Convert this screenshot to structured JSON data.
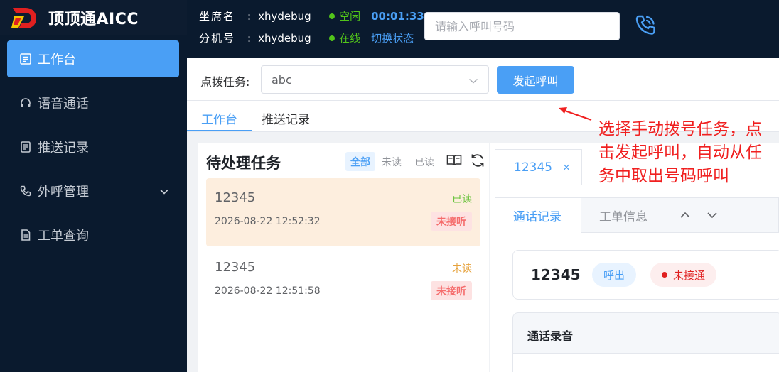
{
  "brand": {
    "title": "顶顶通AICC",
    "logo_colors": [
      "#e02020",
      "#f5c400"
    ]
  },
  "sidebar": {
    "items": [
      {
        "label": "工作台",
        "icon": "dashboard-icon",
        "active": true
      },
      {
        "label": "语音通话",
        "icon": "headset-icon"
      },
      {
        "label": "推送记录",
        "icon": "record-icon"
      },
      {
        "label": "外呼管理",
        "icon": "phone-icon",
        "expandable": true
      },
      {
        "label": "工单查询",
        "icon": "document-icon"
      }
    ]
  },
  "agent": {
    "name_label": "坐席名",
    "name_value": "xhydebug",
    "status": "空闲",
    "timer": "00:01:33",
    "ext_label": "分机号",
    "ext_value": "xhydebug",
    "online": "在线",
    "switch_label": "切换状态",
    "colon": ":"
  },
  "dial": {
    "placeholder": "请输入呼叫号码"
  },
  "task": {
    "label": "点拨任务:",
    "selected": "abc",
    "call_button": "发起呼叫"
  },
  "tabs": [
    "工作台",
    "推送记录"
  ],
  "pending": {
    "title": "待处理任务",
    "filters": [
      "全部",
      "未读",
      "已读"
    ],
    "items": [
      {
        "number": "12345",
        "time": "2026-08-22 12:52:32",
        "read_status": "已读",
        "call_status": "未接听",
        "selected": true
      },
      {
        "number": "12345",
        "time": "2026-08-22 12:51:58",
        "read_status": "未读",
        "call_status": "未接听",
        "selected": false
      }
    ]
  },
  "detail": {
    "tab_number": "12345",
    "tab_close": "×",
    "sub_tabs": [
      "通话记录",
      "工单信息"
    ],
    "call": {
      "number": "12345",
      "direction": "呼出",
      "status": "未接通"
    },
    "recording_title": "通话录音"
  },
  "annotation": {
    "text": "选择手动拨号任务，点击发起呼叫，自动从任务中取出号码呼叫"
  },
  "colors": {
    "accent": "#4a9ff5",
    "sidebar_bg": "#0a1a2e",
    "danger": "#f56c6c",
    "success": "#67c23a",
    "warning": "#e6a23c",
    "annotation": "#f02020"
  }
}
